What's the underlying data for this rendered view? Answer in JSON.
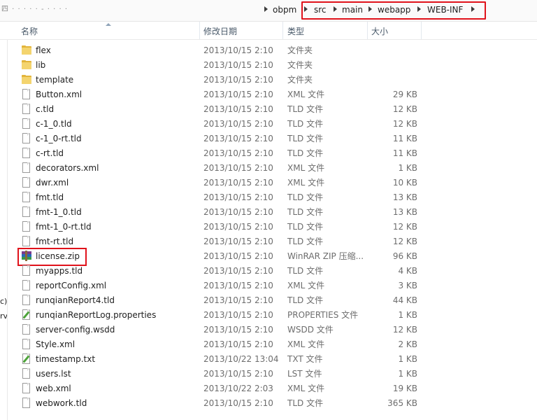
{
  "address": {
    "blurred_prefix": "四  · · · · ·  - · ·  ·  ·",
    "crumbs": [
      "obpm",
      "src",
      "main",
      "webapp",
      "WEB-INF"
    ]
  },
  "columns": {
    "name": "名称",
    "date": "修改日期",
    "type": "类型",
    "size": "大小"
  },
  "left_pane_fragments": [
    "c)",
    "rv"
  ],
  "files": [
    {
      "name": "flex",
      "date": "2013/10/15 2:10",
      "type": "文件夹",
      "size": "",
      "icon": "folder-icon"
    },
    {
      "name": "lib",
      "date": "2013/10/15 2:10",
      "type": "文件夹",
      "size": "",
      "icon": "folder-icon"
    },
    {
      "name": "template",
      "date": "2013/10/15 2:10",
      "type": "文件夹",
      "size": "",
      "icon": "folder-icon"
    },
    {
      "name": "Button.xml",
      "date": "2013/10/15 2:10",
      "type": "XML 文件",
      "size": "29 KB",
      "icon": "file-icon"
    },
    {
      "name": "c.tld",
      "date": "2013/10/15 2:10",
      "type": "TLD 文件",
      "size": "12 KB",
      "icon": "file-icon"
    },
    {
      "name": "c-1_0.tld",
      "date": "2013/10/15 2:10",
      "type": "TLD 文件",
      "size": "12 KB",
      "icon": "file-icon"
    },
    {
      "name": "c-1_0-rt.tld",
      "date": "2013/10/15 2:10",
      "type": "TLD 文件",
      "size": "11 KB",
      "icon": "file-icon"
    },
    {
      "name": "c-rt.tld",
      "date": "2013/10/15 2:10",
      "type": "TLD 文件",
      "size": "11 KB",
      "icon": "file-icon"
    },
    {
      "name": "decorators.xml",
      "date": "2013/10/15 2:10",
      "type": "XML 文件",
      "size": "1 KB",
      "icon": "file-icon"
    },
    {
      "name": "dwr.xml",
      "date": "2013/10/15 2:10",
      "type": "XML 文件",
      "size": "10 KB",
      "icon": "file-icon"
    },
    {
      "name": "fmt.tld",
      "date": "2013/10/15 2:10",
      "type": "TLD 文件",
      "size": "13 KB",
      "icon": "file-icon"
    },
    {
      "name": "fmt-1_0.tld",
      "date": "2013/10/15 2:10",
      "type": "TLD 文件",
      "size": "13 KB",
      "icon": "file-icon"
    },
    {
      "name": "fmt-1_0-rt.tld",
      "date": "2013/10/15 2:10",
      "type": "TLD 文件",
      "size": "12 KB",
      "icon": "file-icon"
    },
    {
      "name": "fmt-rt.tld",
      "date": "2013/10/15 2:10",
      "type": "TLD 文件",
      "size": "12 KB",
      "icon": "file-icon"
    },
    {
      "name": "license.zip",
      "date": "2013/10/15 2:10",
      "type": "WinRAR ZIP 压缩...",
      "size": "96 KB",
      "icon": "zip-archive-icon",
      "highlighted": true
    },
    {
      "name": "myapps.tld",
      "date": "2013/10/15 2:10",
      "type": "TLD 文件",
      "size": "4 KB",
      "icon": "file-icon"
    },
    {
      "name": "reportConfig.xml",
      "date": "2013/10/15 2:10",
      "type": "XML 文件",
      "size": "3 KB",
      "icon": "file-icon"
    },
    {
      "name": "runqianReport4.tld",
      "date": "2013/10/15 2:10",
      "type": "TLD 文件",
      "size": "44 KB",
      "icon": "file-icon"
    },
    {
      "name": "runqianReportLog.properties",
      "date": "2013/10/15 2:10",
      "type": "PROPERTIES 文件",
      "size": "1 KB",
      "icon": "edit-document-icon"
    },
    {
      "name": "server-config.wsdd",
      "date": "2013/10/15 2:10",
      "type": "WSDD 文件",
      "size": "12 KB",
      "icon": "file-icon"
    },
    {
      "name": "Style.xml",
      "date": "2013/10/15 2:10",
      "type": "XML 文件",
      "size": "2 KB",
      "icon": "file-icon"
    },
    {
      "name": "timestamp.txt",
      "date": "2013/10/22 13:04",
      "type": "TXT 文件",
      "size": "1 KB",
      "icon": "edit-document-icon"
    },
    {
      "name": "users.lst",
      "date": "2013/10/15 2:10",
      "type": "LST 文件",
      "size": "1 KB",
      "icon": "file-icon"
    },
    {
      "name": "web.xml",
      "date": "2013/10/22 2:03",
      "type": "XML 文件",
      "size": "19 KB",
      "icon": "file-icon"
    },
    {
      "name": "webwork.tld",
      "date": "2013/10/15 2:10",
      "type": "TLD 文件",
      "size": "365 KB",
      "icon": "file-icon"
    }
  ],
  "colors": {
    "highlight_border": "#e0121b",
    "folder": "#f4d46e",
    "header_text": "#4a5a6a",
    "secondary_text": "#6d6d6d"
  }
}
